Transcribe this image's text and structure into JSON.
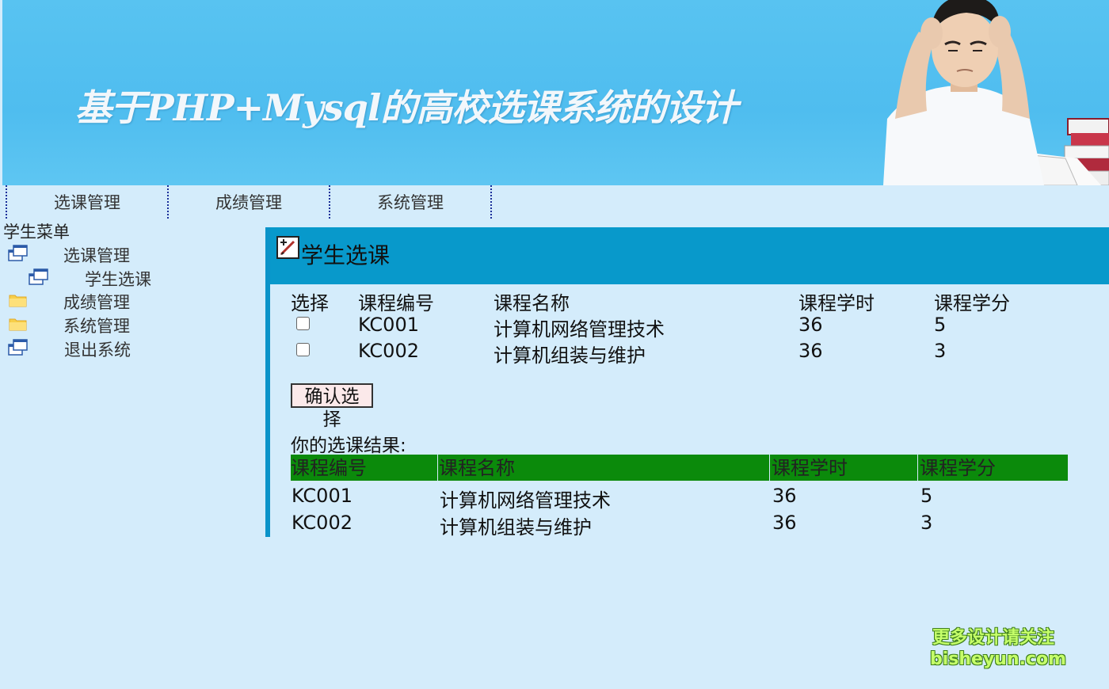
{
  "banner": {
    "title": "基于PHP+Mysql的高校选课系统的设计"
  },
  "topnav": {
    "items": [
      {
        "label": "选课管理"
      },
      {
        "label": "成绩管理"
      },
      {
        "label": "系统管理"
      }
    ]
  },
  "sidemenu": {
    "title": "学生菜单",
    "items": [
      {
        "label": "选课管理",
        "icon": "window-icon"
      },
      {
        "label": "学生选课",
        "icon": "window-icon"
      },
      {
        "label": "成绩管理",
        "icon": "folder-icon"
      },
      {
        "label": "系统管理",
        "icon": "folder-icon"
      },
      {
        "label": "退出系统",
        "icon": "window-icon"
      }
    ]
  },
  "main": {
    "title": "学生选课",
    "course_table": {
      "headers": [
        "选择",
        "课程编号",
        "课程名称",
        "课程学时",
        "课程学分"
      ],
      "rows": [
        {
          "id": "KC001",
          "name": "计算机网络管理技术",
          "hours": "36",
          "credits": "5",
          "checked": false
        },
        {
          "id": "KC002",
          "name": "计算机组装与维护",
          "hours": "36",
          "credits": "3",
          "checked": false
        }
      ]
    },
    "confirm_label": "确认选择",
    "result_label": "你的选课结果:",
    "result_table": {
      "headers": [
        "课程编号",
        "课程名称",
        "课程学时",
        "课程学分"
      ],
      "rows": [
        {
          "id": "KC001",
          "name": "计算机网络管理技术",
          "hours": "36",
          "credits": "5"
        },
        {
          "id": "KC002",
          "name": "计算机组装与维护",
          "hours": "36",
          "credits": "3"
        }
      ]
    }
  },
  "watermark": {
    "line1": "更多设计请关注",
    "line2": "bisheyun.com"
  },
  "colors": {
    "background": "#d4ecfb",
    "banner": "#58c3f1",
    "panel_header": "#0899cb",
    "result_header": "#0b8a0b",
    "nav_separator": "#1b2f9a"
  }
}
